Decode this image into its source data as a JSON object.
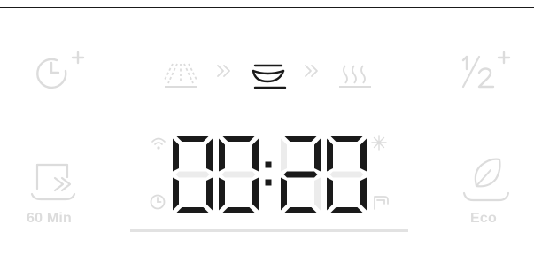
{
  "colors": {
    "active": "#1a1a1a",
    "inactive": "#dcdcdc",
    "segment_off": "#ececec",
    "rule": "#1a1a1a",
    "progress_track": "#e2e2e2"
  },
  "left_options": [
    {
      "name": "time-delay-plus-option",
      "icon": "clock-plus-icon",
      "label": ""
    },
    {
      "name": "speed-option",
      "icon": "fast-forward-basket-icon",
      "label": "60 Min"
    }
  ],
  "right_options": [
    {
      "name": "half-load-option",
      "icon": "half-load-icon",
      "label": ""
    },
    {
      "name": "eco-option",
      "icon": "leaf-icon",
      "label": "Eco"
    }
  ],
  "cycle_phases": [
    {
      "name": "prewash",
      "icon": "spray-icon",
      "active": false
    },
    {
      "name": "main-wash",
      "icon": "wash-bowl-icon",
      "active": true
    },
    {
      "name": "drying",
      "icon": "heat-waves-icon",
      "active": false
    }
  ],
  "display": {
    "time": "00:20"
  },
  "status_icons": {
    "wifi": "wifi-icon",
    "rinse_aid": "sparkle-icon",
    "timer": "clock-icon",
    "water_tap": "tap-icon"
  },
  "progress": 0
}
